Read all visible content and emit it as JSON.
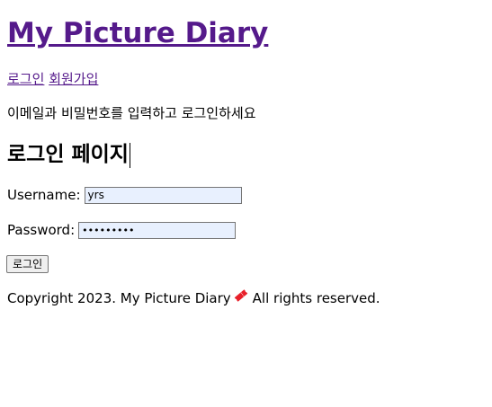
{
  "header": {
    "site_title": "My Picture Diary"
  },
  "nav": {
    "login_link": "로그인",
    "signup_link": "회원가입"
  },
  "instruction": "이메일과 비밀번호를 입력하고 로그인하세요",
  "login_page": {
    "heading": "로그인 페이지",
    "username_label": "Username:",
    "username_value": "yrs",
    "password_label": "Password:",
    "password_value": "•••••••••",
    "submit_label": "로그인"
  },
  "footer": {
    "text_before": "Copyright 2023. My Picture Diary",
    "icon": "ticket-icon",
    "text_after": "All rights reserved."
  },
  "colors": {
    "link_visited": "#551a8b",
    "autofill_bg": "#e8f0fe",
    "icon_red": "#e8202a"
  }
}
